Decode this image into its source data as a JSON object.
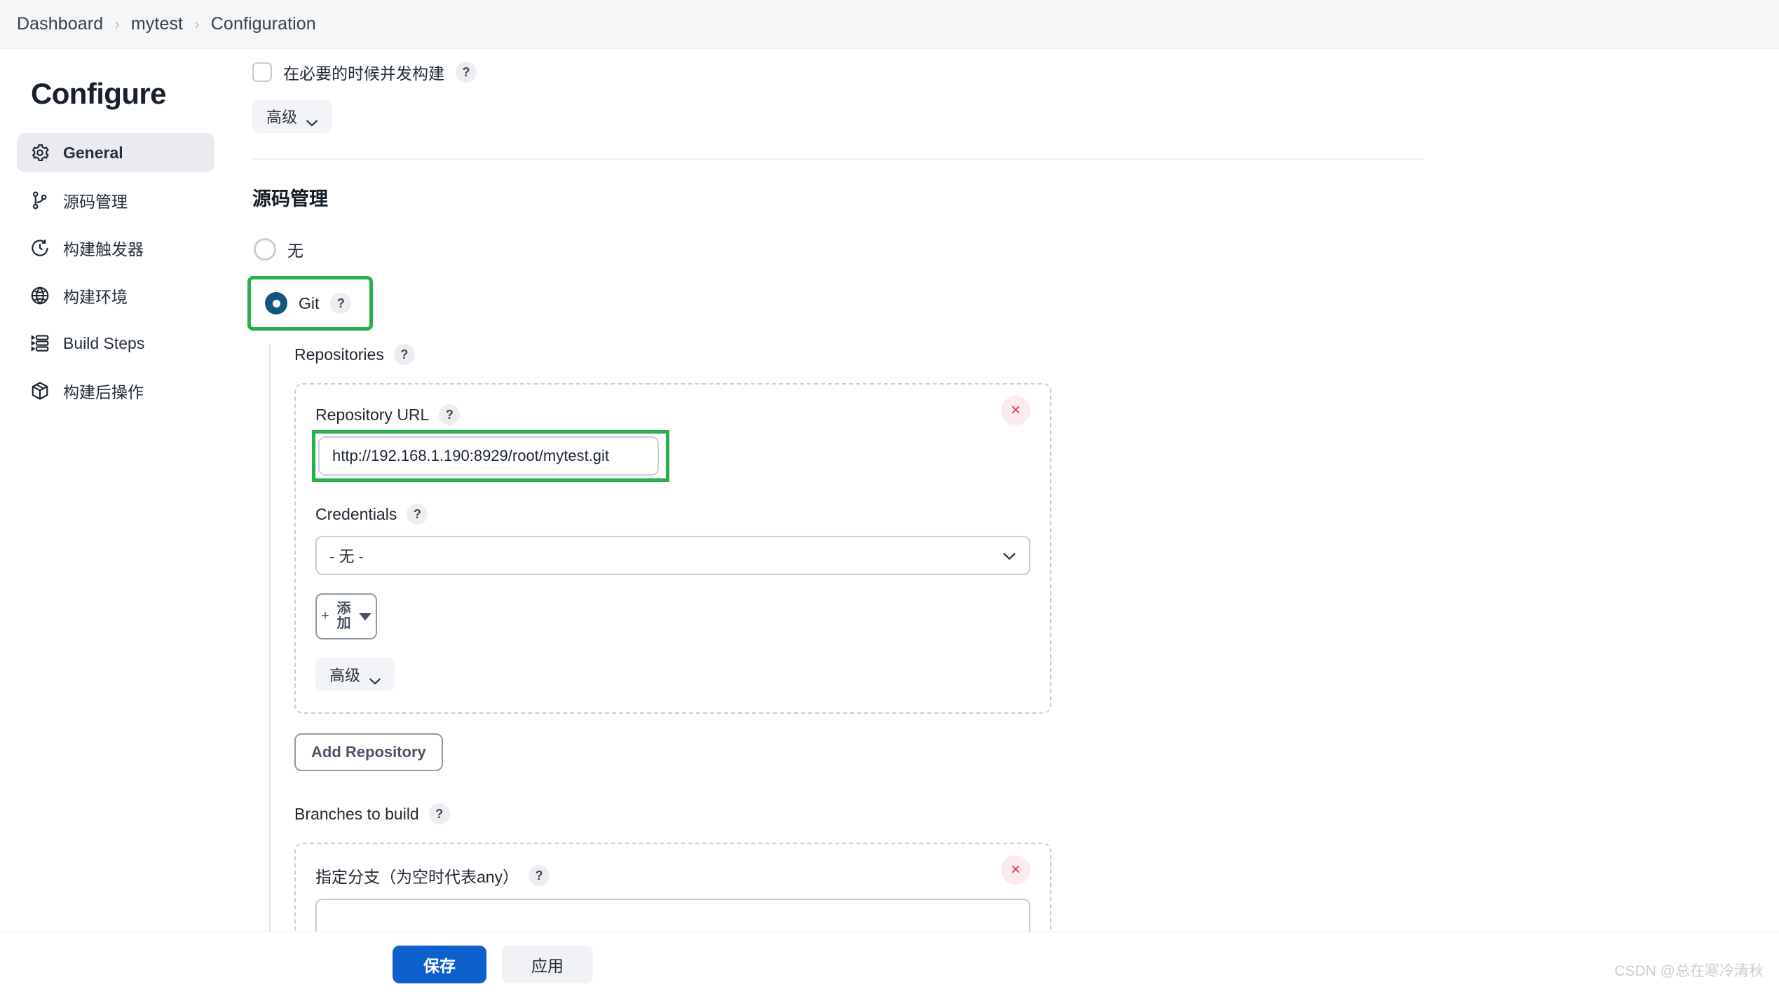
{
  "breadcrumb": {
    "items": [
      "Dashboard",
      "mytest",
      "Configuration"
    ],
    "separator": "›"
  },
  "sidebar": {
    "title": "Configure",
    "items": [
      {
        "label": "General",
        "icon": "gear-icon",
        "active": true
      },
      {
        "label": "源码管理",
        "icon": "git-branch-icon",
        "active": false
      },
      {
        "label": "构建触发器",
        "icon": "clock-icon",
        "active": false
      },
      {
        "label": "构建环境",
        "icon": "globe-icon",
        "active": false
      },
      {
        "label": "Build Steps",
        "icon": "list-steps-icon",
        "active": false
      },
      {
        "label": "构建后操作",
        "icon": "package-icon",
        "active": false
      }
    ]
  },
  "main": {
    "concurrent_build": {
      "label": "在必要的时候并发构建",
      "checked": false,
      "help": "?"
    },
    "advanced_top": {
      "label": "高级"
    },
    "scm": {
      "section_title": "源码管理",
      "options": [
        {
          "label": "无",
          "selected": false
        },
        {
          "label": "Git",
          "selected": true,
          "help": "?",
          "highlighted": true
        }
      ],
      "repositories": {
        "label": "Repositories",
        "help": "?",
        "repository_url": {
          "label": "Repository URL",
          "help": "?",
          "value": "http://192.168.1.190:8929/root/mytest.git",
          "placeholder": "",
          "highlighted": true
        },
        "credentials": {
          "label": "Credentials",
          "help": "?",
          "selected": "- 无 -",
          "options": [
            "- 无 -"
          ]
        },
        "add_button": {
          "label": "添加",
          "plus": "+"
        },
        "advanced_button": {
          "label": "高级"
        },
        "delete_button": {
          "label": "×"
        }
      },
      "add_repository_button": {
        "label": "Add Repository"
      },
      "branches": {
        "label": "Branches to build",
        "help": "?",
        "branch_spec": {
          "label": "指定分支（为空时代表any）",
          "help": "?",
          "value": ""
        },
        "delete_button": {
          "label": "×"
        }
      }
    }
  },
  "footer": {
    "save_label": "保存",
    "apply_label": "应用"
  },
  "watermark": "CSDN @总在寒冷清秋",
  "colors": {
    "highlight_green": "#27b04b",
    "primary_blue": "#0d5fce",
    "radio_selected": "#12567e",
    "delete_red": "#e3344a"
  }
}
